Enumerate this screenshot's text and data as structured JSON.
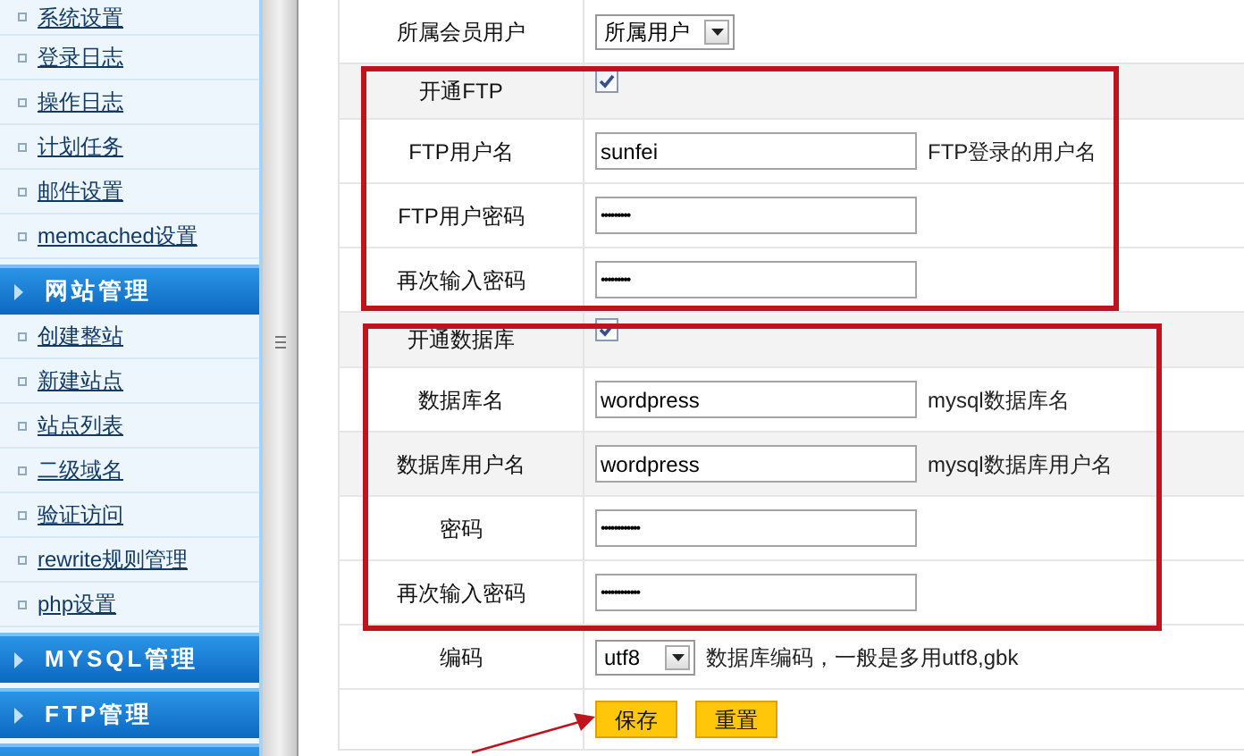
{
  "sidebar": {
    "items": [
      {
        "kind": "link",
        "label": "系统设置"
      },
      {
        "kind": "link",
        "label": "登录日志"
      },
      {
        "kind": "link",
        "label": "操作日志"
      },
      {
        "kind": "link",
        "label": "计划任务"
      },
      {
        "kind": "link",
        "label": "邮件设置"
      },
      {
        "kind": "link",
        "label": "memcached设置"
      },
      {
        "kind": "header",
        "label": "网站管理"
      },
      {
        "kind": "link",
        "label": "创建整站"
      },
      {
        "kind": "link",
        "label": "新建站点"
      },
      {
        "kind": "link",
        "label": "站点列表"
      },
      {
        "kind": "link",
        "label": "二级域名"
      },
      {
        "kind": "link",
        "label": "验证访问"
      },
      {
        "kind": "link",
        "label": "rewrite规则管理"
      },
      {
        "kind": "link",
        "label": "php设置"
      },
      {
        "kind": "header",
        "label": "MYSQL管理"
      },
      {
        "kind": "header",
        "label": "FTP管理"
      },
      {
        "kind": "header"
      }
    ]
  },
  "form": {
    "rows": [
      {
        "kind": "select",
        "label": "所属会员用户",
        "value": "所属用户"
      },
      {
        "kind": "checkbox",
        "label": "开通FTP",
        "checked": true
      },
      {
        "kind": "text",
        "label": "FTP用户名",
        "value": "sunfei",
        "hint": "FTP登录的用户名"
      },
      {
        "kind": "password",
        "label": "FTP用户密码",
        "value": "•••••••••"
      },
      {
        "kind": "password",
        "label": "再次输入密码",
        "value": "•••••••••"
      },
      {
        "kind": "checkbox",
        "label": "开通数据库",
        "checked": true
      },
      {
        "kind": "text",
        "label": "数据库名",
        "value": "wordpress",
        "hint": "mysql数据库名"
      },
      {
        "kind": "text",
        "label": "数据库用户名",
        "value": "wordpress",
        "hint": "mysql数据库用户名"
      },
      {
        "kind": "password",
        "label": "密码",
        "value": "••••••••••••"
      },
      {
        "kind": "password",
        "label": "再次输入密码",
        "value": "••••••••••••"
      },
      {
        "kind": "select",
        "label": "编码",
        "value": "utf8",
        "hint": "数据库编码，一般是多用utf8,gbk"
      }
    ],
    "buttons": [
      "保存",
      "重置"
    ]
  }
}
